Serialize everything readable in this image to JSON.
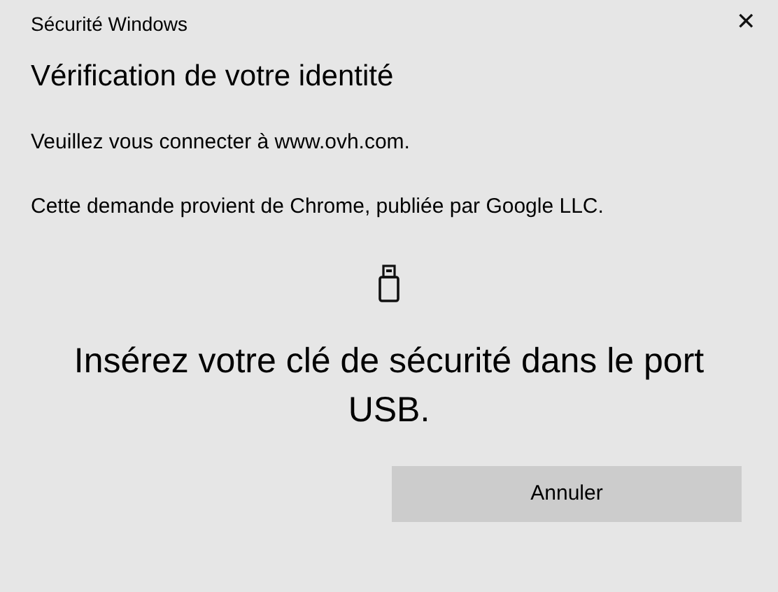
{
  "window": {
    "title": "Sécurité Windows",
    "close": "✕"
  },
  "heading": "Vérification de votre identité",
  "messages": [
    "Veuillez vous connecter à www.ovh.com.",
    "Cette demande provient de Chrome, publiée par Google LLC."
  ],
  "prompt": "Insérez votre clé de sécurité dans le port USB.",
  "buttons": [
    {
      "label": "Annuler"
    }
  ]
}
